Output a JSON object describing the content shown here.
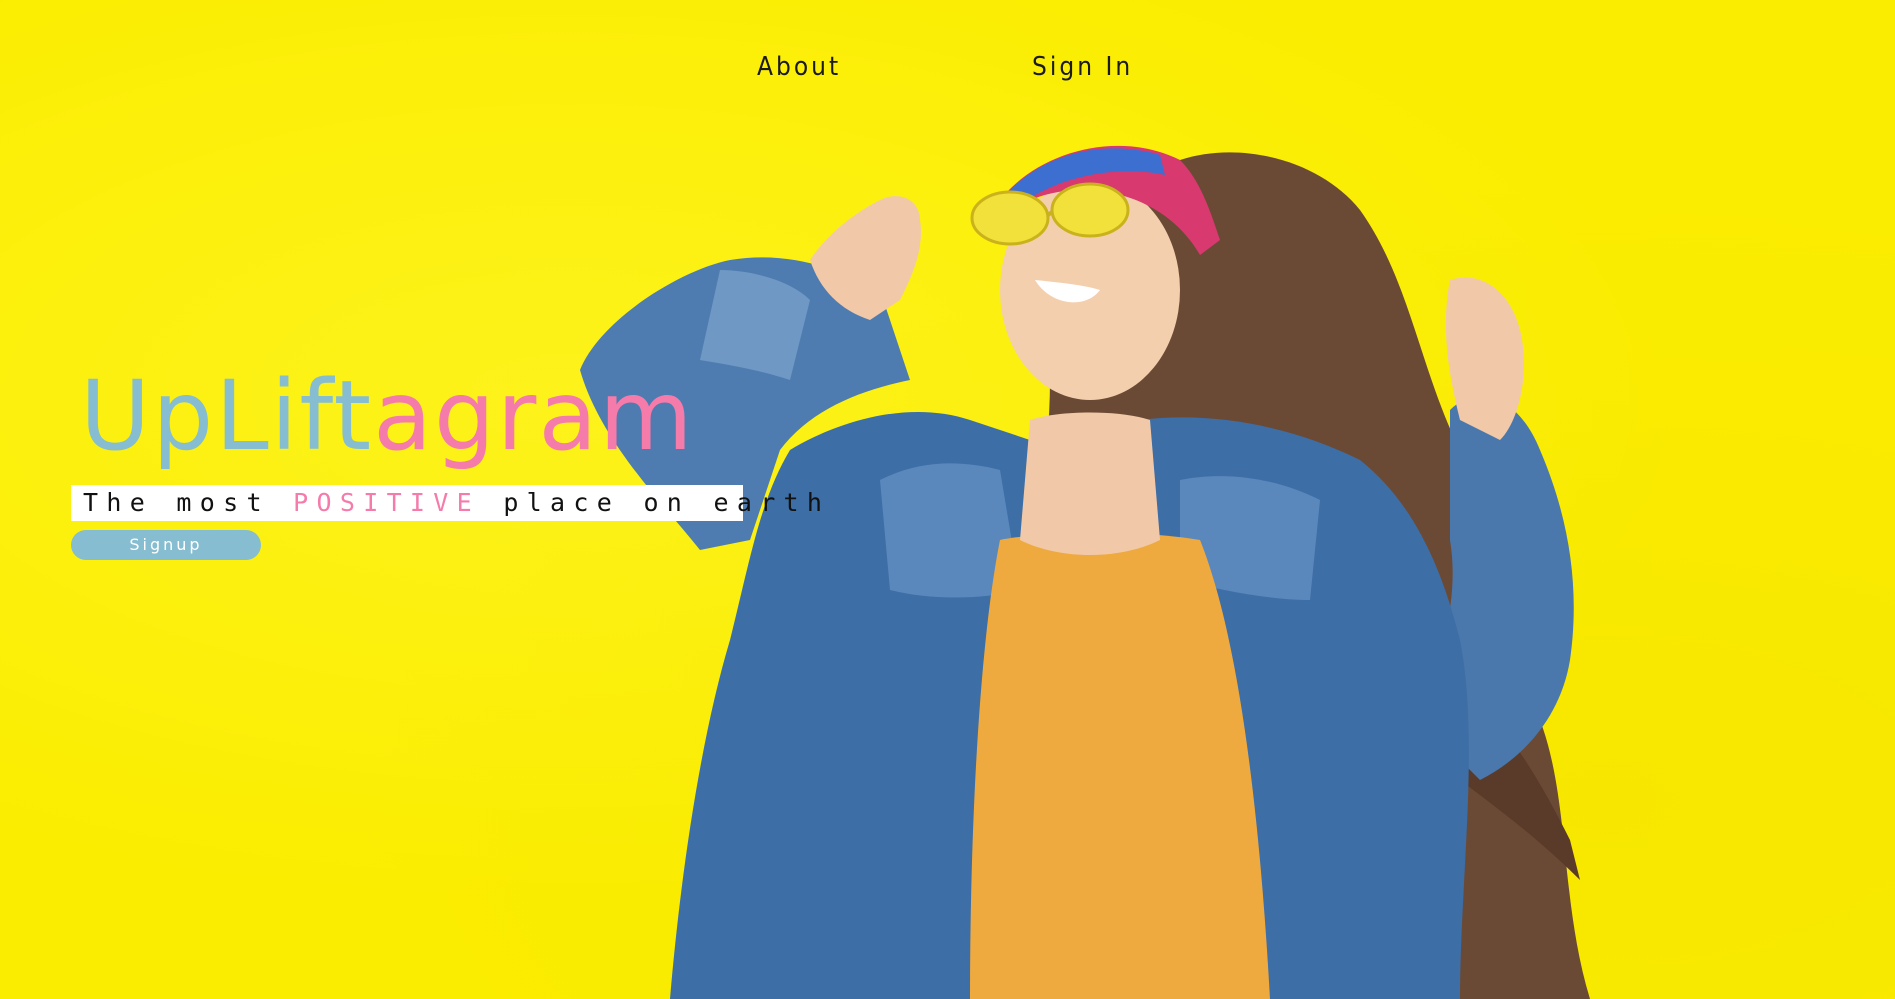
{
  "nav": {
    "about": "About",
    "sign_in": "Sign In"
  },
  "brand": {
    "part1": "UpLift",
    "part2": "agram"
  },
  "tagline": {
    "before": "The most ",
    "highlight": "POSITIVE",
    "after": " place on earth"
  },
  "signup": {
    "label": "Signup"
  },
  "colors": {
    "background": "#fbed00",
    "brand_blue": "#86bdd1",
    "brand_pink": "#f57bab"
  },
  "hero_image": {
    "subject": "laughing woman in denim jacket and yellow sunglasses"
  }
}
